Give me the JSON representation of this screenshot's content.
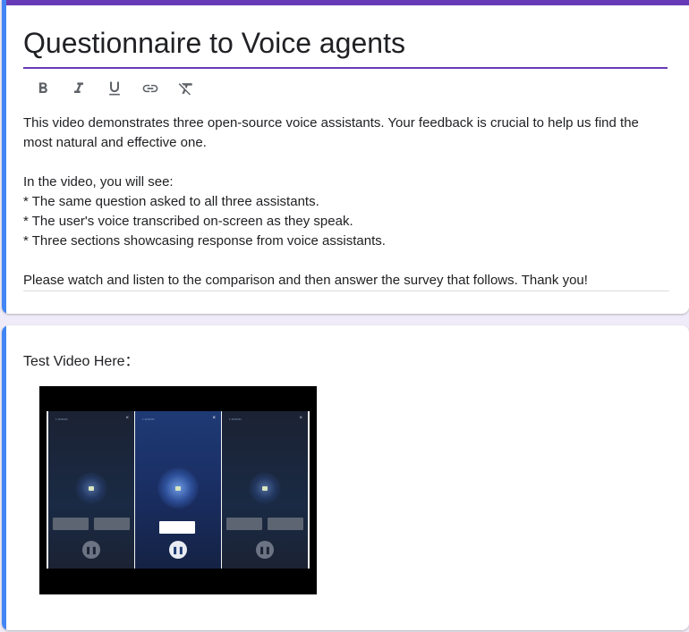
{
  "form": {
    "title": "Questionnaire to Voice agents",
    "description": {
      "intro": "This video demonstrates three open-source voice assistants. Your feedback is crucial to help us find the most natural and effective one.",
      "list_header": "In the video, you will see:",
      "items": [
        "* The same question asked to all three assistants.",
        "* The user's voice transcribed on-screen as they speak.",
        "* Three sections showcasing response from voice assistants."
      ],
      "closing": "Please watch and listen to the comparison and then answer the survey that follows. Thank you!"
    },
    "toolbar": {
      "bold_icon": "bold-icon",
      "italic_icon": "italic-icon",
      "underline_icon": "underline-icon",
      "link_icon": "link-icon",
      "clear_format_icon": "clear-formatting-icon"
    }
  },
  "question": {
    "title": "Test Video Here："
  },
  "colors": {
    "accent": "#673ab7",
    "left_bar": "#4285f4",
    "background": "#f0ebf8"
  }
}
